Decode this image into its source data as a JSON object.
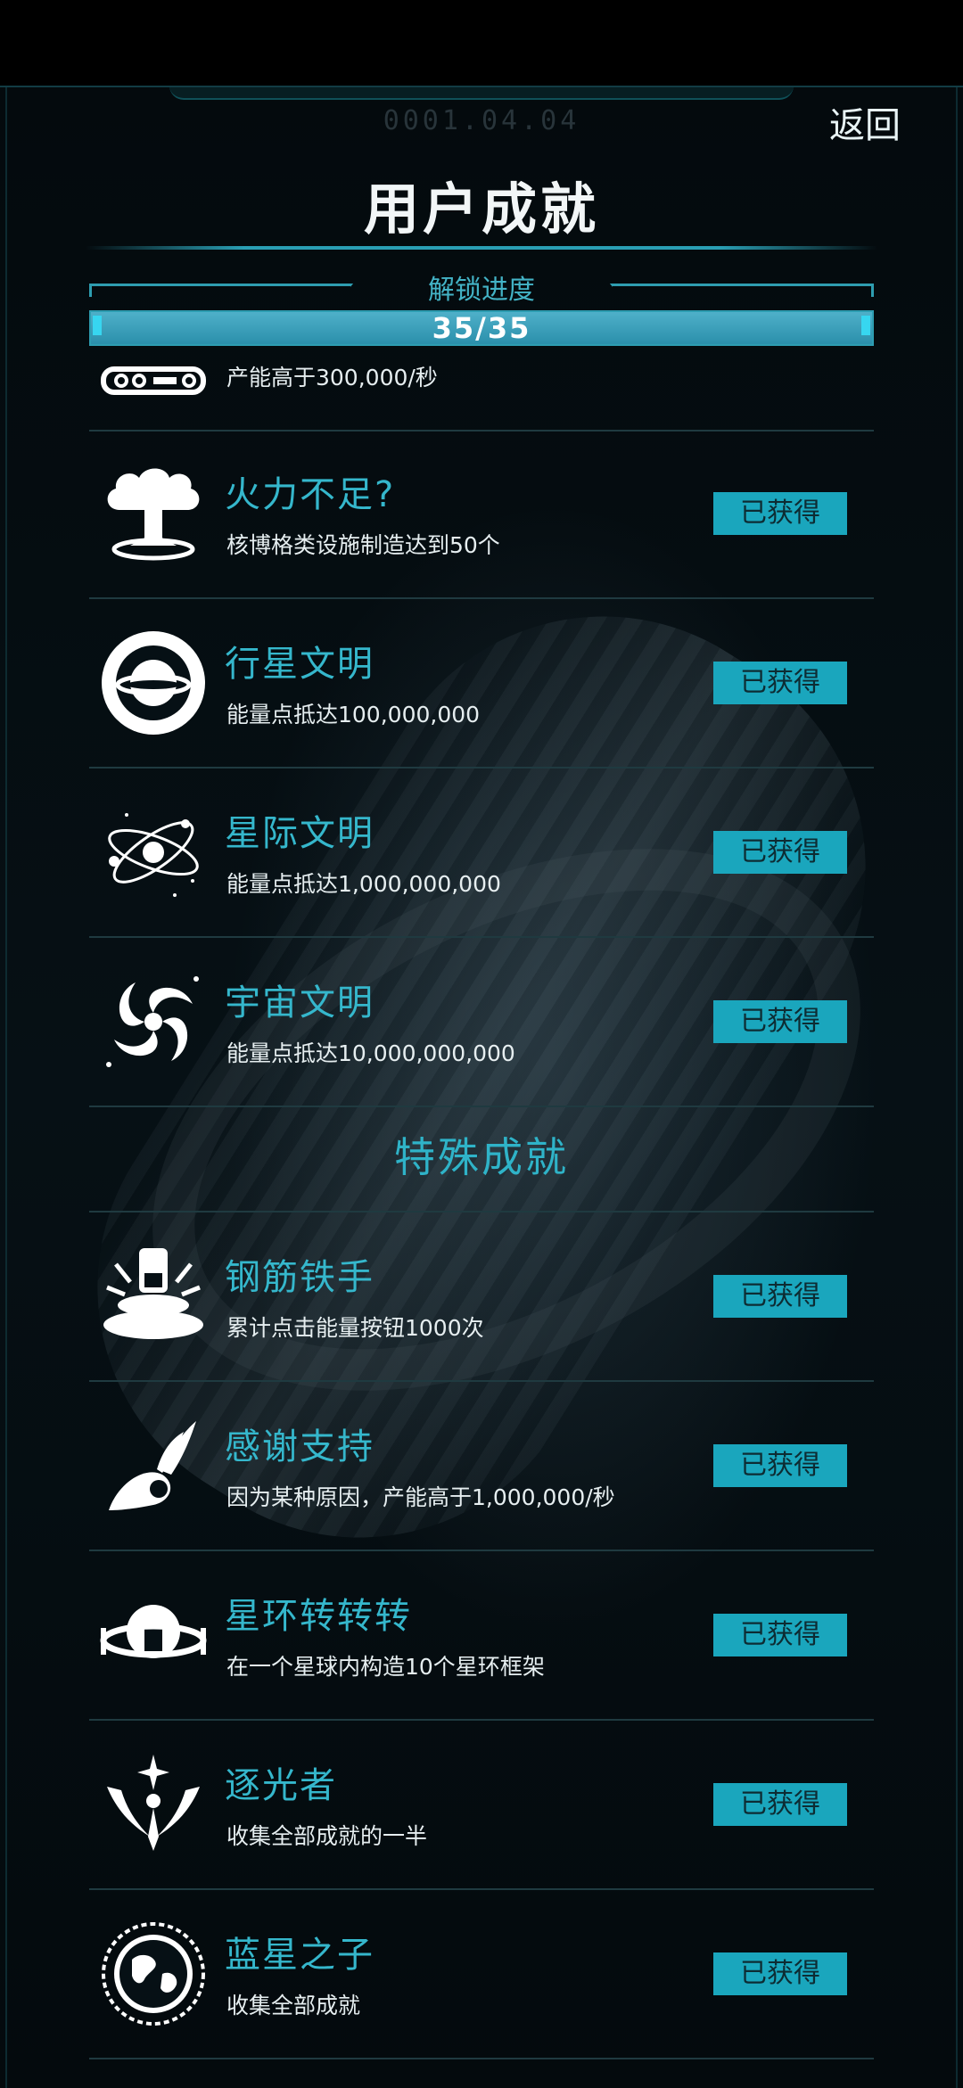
{
  "header": {
    "date": "0001.04.04",
    "back_label": "返回",
    "title": "用户成就"
  },
  "progress": {
    "label": "解锁进度",
    "text": "35/35",
    "fraction": 1.0
  },
  "partial_row": {
    "desc": "产能高于300,000/秒"
  },
  "achievements": [
    {
      "name": "火力不足?",
      "desc": "核博格类设施制造达到50个",
      "status": "已获得",
      "icon": "mushroom-cloud-icon"
    },
    {
      "name": "行星文明",
      "desc": "能量点抵达100,000,000",
      "status": "已获得",
      "icon": "planet-icon"
    },
    {
      "name": "星际文明",
      "desc": "能量点抵达1,000,000,000",
      "status": "已获得",
      "icon": "atom-orbit-icon"
    },
    {
      "name": "宇宙文明",
      "desc": "能量点抵达10,000,000,000",
      "status": "已获得",
      "icon": "spiral-galaxy-icon"
    }
  ],
  "special_section": {
    "title": "特殊成就"
  },
  "special_achievements": [
    {
      "name": "钢筋铁手",
      "desc": "累计点击能量按钮1000次",
      "status": "已获得",
      "icon": "pressing-button-icon"
    },
    {
      "name": "感谢支持",
      "desc": "因为某种原因，产能高于1,000,000/秒",
      "status": "已获得",
      "icon": "ok-hand-icon"
    },
    {
      "name": "星环转转转",
      "desc": "在一个星球内构造10个星环框架",
      "status": "已获得",
      "icon": "star-ring-icon"
    },
    {
      "name": "逐光者",
      "desc": "收集全部成就的一半",
      "status": "已获得",
      "icon": "light-chaser-icon"
    },
    {
      "name": "蓝星之子",
      "desc": "收集全部成就",
      "status": "已获得",
      "icon": "earth-emblem-icon"
    }
  ],
  "colors": {
    "accent": "#35b7cc",
    "badge": "#1aa6bd",
    "background": "#040a0d"
  }
}
